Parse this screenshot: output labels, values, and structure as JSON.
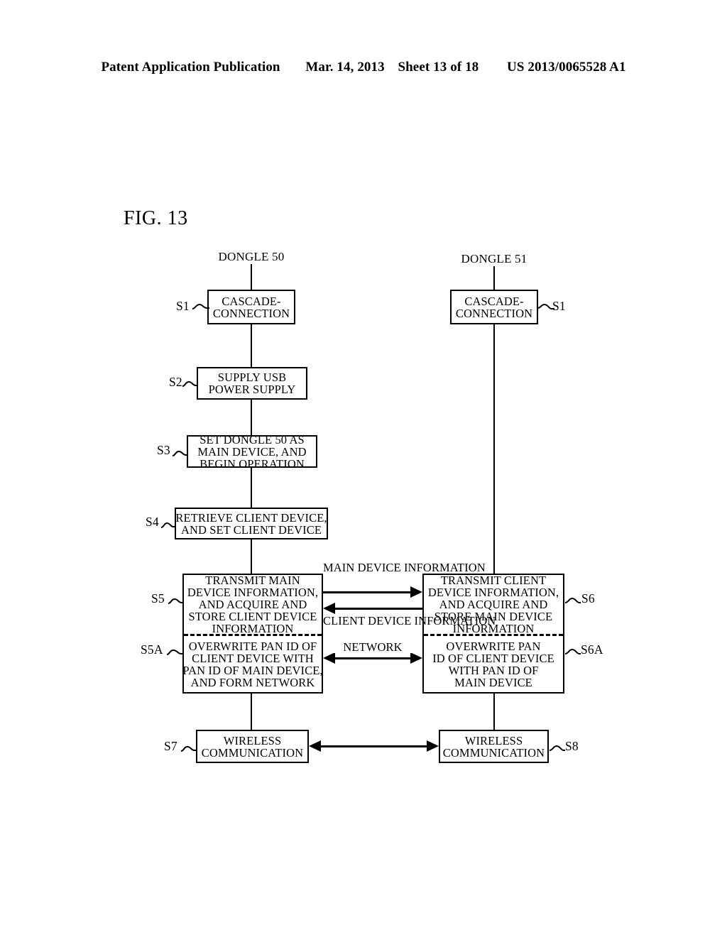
{
  "header": {
    "publication": "Patent Application Publication",
    "date": "Mar. 14, 2013",
    "sheet": "Sheet 13 of 18",
    "pub_number": "US 2013/0065528 A1"
  },
  "figure": {
    "label": "FIG. 13"
  },
  "columns": {
    "left_title": "DONGLE 50",
    "right_title": "DONGLE 51"
  },
  "left_column": {
    "s1": {
      "ref": "S1",
      "lines": [
        "CASCADE-",
        "CONNECTION"
      ]
    },
    "s2": {
      "ref": "S2",
      "lines": [
        "SUPPLY USB",
        "POWER SUPPLY"
      ]
    },
    "s3": {
      "ref": "S3",
      "lines": [
        "SET DONGLE 50 AS",
        "MAIN DEVICE, AND",
        "BEGIN OPERATION"
      ]
    },
    "s4": {
      "ref": "S4",
      "lines": [
        "RETRIEVE CLIENT DEVICE,",
        "AND SET CLIENT DEVICE"
      ]
    },
    "s5": {
      "ref": "S5",
      "lines": [
        "TRANSMIT MAIN",
        "DEVICE INFORMATION,",
        "AND ACQUIRE AND",
        "STORE CLIENT DEVICE",
        "INFORMATION"
      ]
    },
    "s5a": {
      "ref": "S5A",
      "lines": [
        "OVERWRITE PAN ID OF",
        "CLIENT DEVICE WITH",
        "PAN ID OF MAIN DEVICE,",
        "AND FORM NETWORK"
      ]
    },
    "s7": {
      "ref": "S7",
      "lines": [
        "WIRELESS",
        "COMMUNICATION"
      ]
    }
  },
  "right_column": {
    "s1": {
      "ref": "S1",
      "lines": [
        "CASCADE-",
        "CONNECTION"
      ]
    },
    "s6": {
      "ref": "S6",
      "lines": [
        "TRANSMIT CLIENT",
        "DEVICE INFORMATION,",
        "AND ACQUIRE AND",
        "STORE MAIN DEVICE",
        "INFORMATION"
      ]
    },
    "s6a": {
      "ref": "S6A",
      "lines": [
        "OVERWRITE PAN",
        "ID OF CLIENT DEVICE",
        "WITH PAN ID OF",
        "MAIN DEVICE"
      ]
    },
    "s8": {
      "ref": "S8",
      "lines": [
        "WIRELESS",
        "COMMUNICATION"
      ]
    }
  },
  "interconnects": {
    "main_device_info": [
      "MAIN DEVICE",
      "INFORMATION"
    ],
    "client_device_info": [
      "CLIENT DEVICE",
      "INFORMATION"
    ],
    "network": [
      "NETWORK"
    ]
  },
  "colors": {
    "ink": "#000000",
    "page": "#ffffff"
  }
}
